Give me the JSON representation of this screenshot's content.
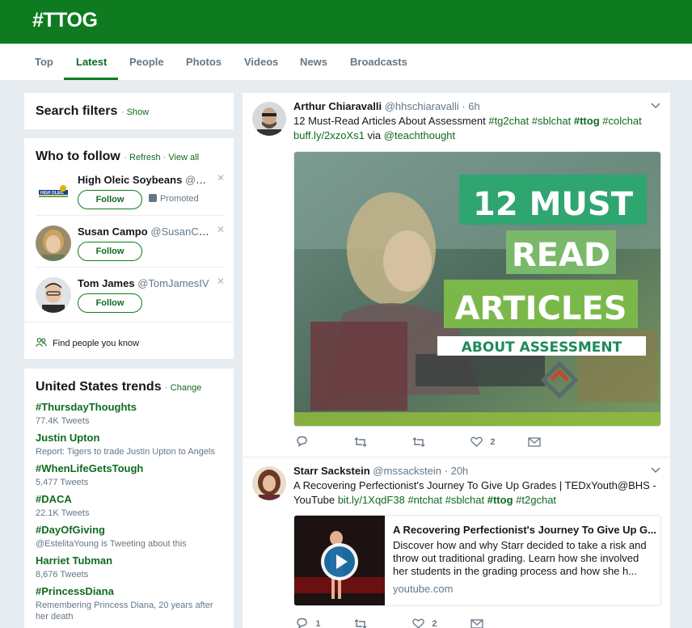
{
  "header": {
    "title": "#TTOG"
  },
  "tabs": [
    "Top",
    "Latest",
    "People",
    "Photos",
    "Videos",
    "News",
    "Broadcasts"
  ],
  "search_filters": {
    "title": "Search filters",
    "show": "Show"
  },
  "who_to_follow": {
    "title": "Who to follow",
    "refresh": "Refresh",
    "view_all": "View all",
    "users": [
      {
        "name": "High Oleic Soybeans",
        "handle": "@H...",
        "button": "Follow",
        "promoted": "Promoted"
      },
      {
        "name": "Susan Campo",
        "handle": "@SusanCa...",
        "button": "Follow"
      },
      {
        "name": "Tom James",
        "handle": "@TomJamesIV",
        "button": "Follow"
      }
    ],
    "find_people": "Find people you know"
  },
  "trends": {
    "title": "United States trends",
    "change": "Change",
    "items": [
      {
        "name": "#ThursdayThoughts",
        "context": "77.4K Tweets"
      },
      {
        "name": "Justin Upton",
        "context": "Report: Tigers to trade Justin Upton to Angels"
      },
      {
        "name": "#WhenLifeGetsTough",
        "context": "5,477 Tweets"
      },
      {
        "name": "#DACA",
        "context": "22.1K Tweets"
      },
      {
        "name": "#DayOfGiving",
        "context": "@EstelitaYoung is Tweeting about this"
      },
      {
        "name": "Harriet Tubman",
        "context": "8,676 Tweets"
      },
      {
        "name": "#PrincessDiana",
        "context": "Remembering Princess Diana, 20 years after her death"
      }
    ]
  },
  "tweets": [
    {
      "name": "Arthur Chiaravalli",
      "handle": "@hhschiaravalli",
      "time": "6h",
      "text_plain1": "12 Must-Read Articles About Assessment ",
      "tags1": "#tg2chat #sblchat",
      "tag_bold": "#ttog",
      "tags2": "#colchat",
      "link": "buff.ly/2xzoXs1",
      "via": " via ",
      "via_handle": "@teachthought",
      "image_text": {
        "line1": "12 MUST",
        "line2": "READ",
        "line3": "ARTICLES",
        "line4": "ABOUT ASSESSMENT"
      },
      "likes": "2"
    },
    {
      "name": "Starr Sackstein",
      "handle": "@mssackstein",
      "time": "20h",
      "text_plain1": "A Recovering Perfectionist's Journey To Give Up Grades | TEDxYouth@BHS - YouTube ",
      "link": "bit.ly/1XqdF38",
      "tags1": "#ntchat #sblchat",
      "tag_bold": "#ttog",
      "tags2": "#t2gchat",
      "card": {
        "title": "A Recovering Perfectionist's Journey To Give Up G...",
        "desc": "Discover how and why Starr decided to take a risk and throw out traditional grading. Learn how she involved her students in the grading process and how she h...",
        "domain": "youtube.com"
      },
      "replies": "1",
      "likes": "2"
    }
  ],
  "colors": {
    "brand": "#0f7b20",
    "link": "#0f6b1f",
    "background": "#e6ecf0"
  }
}
